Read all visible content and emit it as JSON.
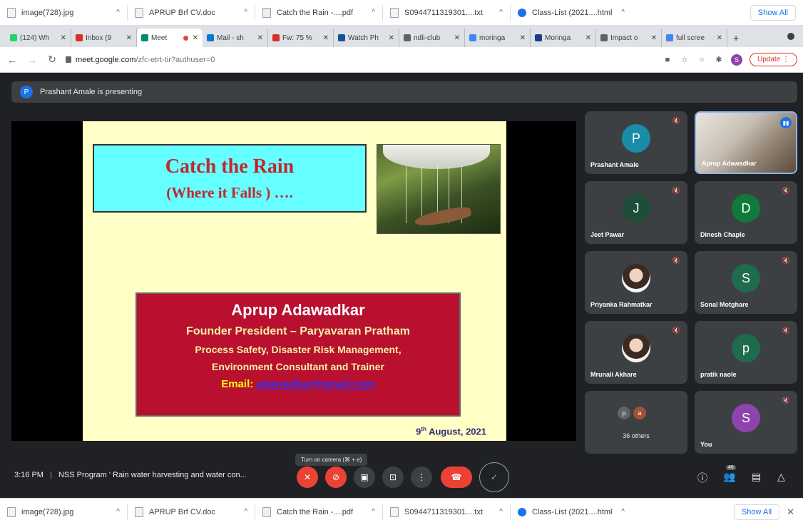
{
  "downloads_top": [
    {
      "name": "image(728).jpg",
      "type": "img"
    },
    {
      "name": "APRUP Brf CV.doc",
      "type": "doc"
    },
    {
      "name": "Catch the Rain -....pdf",
      "type": "pdf"
    },
    {
      "name": "S0944711319301....txt",
      "type": "txt"
    },
    {
      "name": "Class-List (2021....html",
      "type": "html"
    }
  ],
  "downloads_bottom": [
    {
      "name": "image(728).jpg",
      "type": "img"
    },
    {
      "name": "APRUP Brf CV.doc",
      "type": "doc"
    },
    {
      "name": "Catch the Rain -....pdf",
      "type": "pdf"
    },
    {
      "name": "S0944711319301....txt",
      "type": "txt"
    },
    {
      "name": "Class-List (2021....html",
      "type": "html"
    }
  ],
  "show_all_label": "Show All",
  "tabs": [
    {
      "label": "(124) Wh",
      "color": "#25d366",
      "active": false
    },
    {
      "label": "Inbox (9",
      "color": "#d93025",
      "active": false
    },
    {
      "label": "Meet",
      "color": "#00897b",
      "active": true,
      "recording": true
    },
    {
      "label": "Mail - sh",
      "color": "#0078d4",
      "active": false
    },
    {
      "label": "Fw: 75 %",
      "color": "#d93025",
      "active": false
    },
    {
      "label": "Watch Ph",
      "color": "#1a4fa0",
      "active": false
    },
    {
      "label": "ndli-club",
      "color": "#5f6368",
      "active": false
    },
    {
      "label": "moringa",
      "color": "#4285f4",
      "active": false
    },
    {
      "label": "Moringa",
      "color": "#1e3a8a",
      "active": false
    },
    {
      "label": "Impact o",
      "color": "#5f6368",
      "active": false
    },
    {
      "label": "full scree",
      "color": "#4285f4",
      "active": false
    }
  ],
  "address": {
    "host": "meet.google.com",
    "path": "/zfc-etrt-tir?authuser=0"
  },
  "profile_initial": "S",
  "update_label": "Update",
  "presenting": {
    "initial": "P",
    "text": "Prashant Amale is presenting"
  },
  "slide": {
    "title": "Catch the Rain",
    "subtitle": "(Where it Falls ) ….",
    "name": "Aprup Adawadkar",
    "role": "Founder President – Paryavaran Pratham",
    "desc1": "Process Safety, Disaster Risk Management,",
    "desc2": "Environment Consultant  and Trainer",
    "email_label": "Email:",
    "email": "adawadkar@gmail.com",
    "date_day": "9",
    "date_sup": "th",
    "date_rest": " August, 2021"
  },
  "participants": [
    {
      "name": "Prashant Amale",
      "initial": "P",
      "color": "#1a8ca8"
    },
    {
      "name": "Aprup Adawadkar",
      "initial": "",
      "color": "",
      "video": true
    },
    {
      "name": "Jeet Pawar",
      "initial": "J",
      "color": "#1e4d3a"
    },
    {
      "name": "Dinesh Chaple",
      "initial": "D",
      "color": "#0f7b3a"
    },
    {
      "name": "Priyanka Rahmatkar",
      "initial": "",
      "color": "#ffffff",
      "photo": true
    },
    {
      "name": "Sonal Motghare",
      "initial": "S",
      "color": "#1e6b4d"
    },
    {
      "name": "Mrunali Akhare",
      "initial": "",
      "color": "#ffffff",
      "photo": true
    },
    {
      "name": "pratik naole",
      "initial": "p",
      "color": "#1e6b4d"
    },
    {
      "name": "",
      "initial": "",
      "color": "",
      "others": true
    },
    {
      "name": "You",
      "initial": "S",
      "color": "#8e44ad"
    }
  ],
  "others": {
    "label": "36 others",
    "a1": "p",
    "a1_color": "#5f6368",
    "a2": "a",
    "a2_color": "#a1503a"
  },
  "bottom": {
    "time": "3:16 PM",
    "separator": "|",
    "meeting_title": "NSS Program ' Rain water harvesting and water con...",
    "tooltip": "Turn on camera (⌘ + e)",
    "participant_count": "46"
  }
}
